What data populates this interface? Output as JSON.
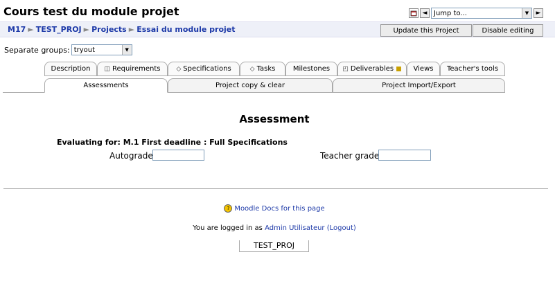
{
  "header": {
    "title": "Cours test du module projet",
    "jump_to": "Jump to...",
    "prev_arrow": "◄",
    "next_arrow": "►"
  },
  "breadcrumb": {
    "items": [
      "M17",
      "TEST_PROJ",
      "Projects",
      "Essai du module projet"
    ],
    "separator": "►"
  },
  "buttons": {
    "update_project": "Update this Project",
    "disable_editing": "Disable editing"
  },
  "groups": {
    "label": "Separate groups:",
    "selected": "tryout"
  },
  "tabs_row1": [
    {
      "label": "Description",
      "icon": ""
    },
    {
      "label": "Requirements",
      "icon": "requirements-icon"
    },
    {
      "label": "Specifications",
      "icon": "diamond-icon"
    },
    {
      "label": "Tasks",
      "icon": "diamond-icon"
    },
    {
      "label": "Milestones",
      "icon": ""
    },
    {
      "label": "Deliverables",
      "icon": "deliverables-icon"
    },
    {
      "label": "Views",
      "icon": ""
    },
    {
      "label": "Teacher's tools",
      "icon": ""
    }
  ],
  "tabs_row2": [
    {
      "label": "Assessments"
    },
    {
      "label": "Project copy & clear"
    },
    {
      "label": "Project Import/Export"
    }
  ],
  "main": {
    "heading": "Assessment",
    "evaluating_for": "Evaluating for: M.1 First deadline : Full Specifications",
    "autograde_label": "Autograde",
    "autograde_value": "",
    "teacher_grade_label": "Teacher grade",
    "teacher_grade_value": ""
  },
  "footer": {
    "docs_link": "Moodle Docs for this page",
    "logged_in_prefix": "You are logged in as",
    "user_name": "Admin Utilisateur",
    "logout": "(Logout)",
    "course_short": "TEST_PROJ"
  },
  "colors": {
    "link": "#1e3aa8",
    "navbar_bg": "#eef0f8"
  }
}
